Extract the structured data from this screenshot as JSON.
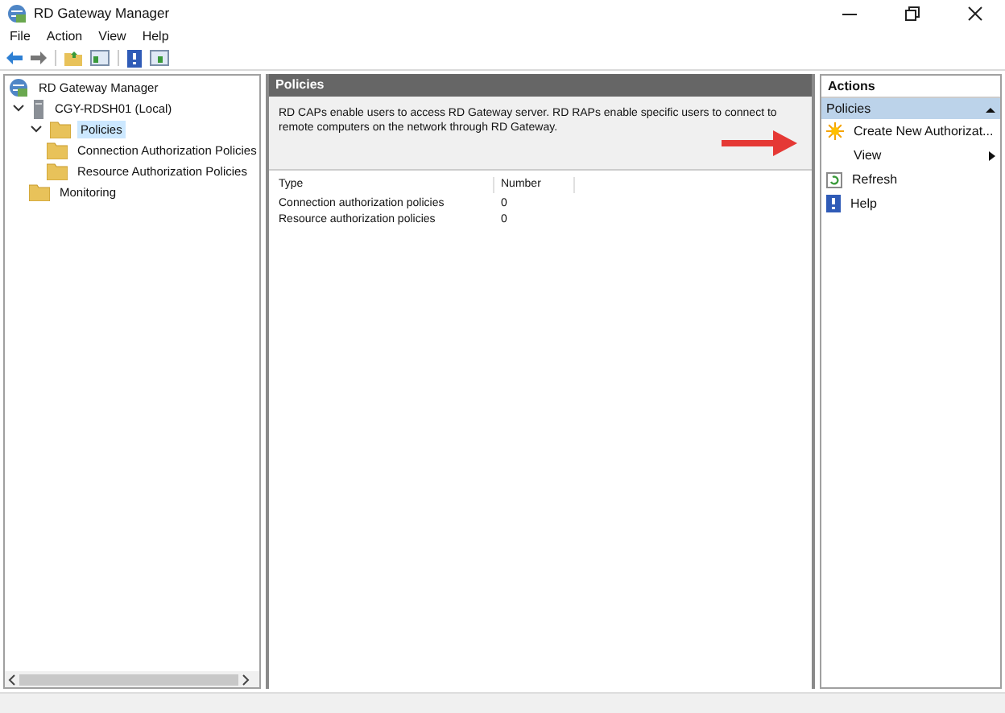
{
  "window": {
    "title": "RD Gateway Manager"
  },
  "menu": [
    "File",
    "Action",
    "View",
    "Help"
  ],
  "tree": [
    {
      "label": "RD Gateway Manager",
      "kind": "root",
      "selected": false,
      "children": [
        {
          "label": "CGY-RDSH01 (Local)",
          "kind": "server",
          "expanded": true,
          "selected": false,
          "children": [
            {
              "label": "Policies",
              "kind": "folder",
              "expanded": true,
              "selected": true,
              "children": [
                {
                  "label": "Connection Authorization Policies",
                  "kind": "folder",
                  "selected": false
                },
                {
                  "label": "Resource Authorization Policies",
                  "kind": "folder",
                  "selected": false
                }
              ]
            },
            {
              "label": "Monitoring",
              "kind": "folder",
              "selected": false
            }
          ]
        }
      ]
    }
  ],
  "center": {
    "title": "Policies",
    "description": "RD CAPs enable users to access RD Gateway server. RD RAPs enable specific users to connect to remote computers on the network through RD Gateway.",
    "columns": [
      "Type",
      "Number"
    ],
    "rows": [
      [
        "Connection authorization policies",
        "0"
      ],
      [
        "Resource authorization policies",
        "0"
      ]
    ]
  },
  "actions": {
    "title": "Actions",
    "section": "Policies",
    "expanded": true,
    "items": [
      {
        "label": "Create New Authorizat...",
        "kind": "create"
      },
      {
        "label": "View",
        "kind": "submenu"
      },
      {
        "label": "Refresh",
        "kind": "refresh"
      },
      {
        "label": "Help",
        "kind": "help"
      }
    ]
  }
}
